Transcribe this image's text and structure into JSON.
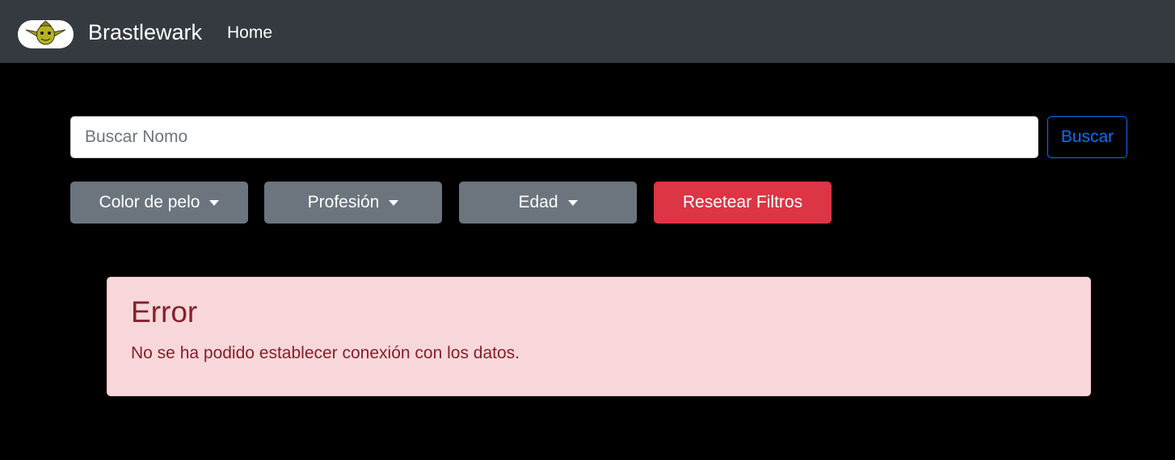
{
  "navbar": {
    "brand_name": "Brastlewark",
    "logo_icon": "goblin-logo-icon",
    "links": [
      {
        "label": "Home"
      }
    ],
    "background": "#343a40"
  },
  "search": {
    "placeholder": "Buscar Nomo",
    "value": "",
    "button_label": "Buscar"
  },
  "filters": [
    {
      "label": "Color de pelo",
      "type": "dropdown"
    },
    {
      "label": "Profesión",
      "type": "dropdown"
    },
    {
      "label": "Edad",
      "type": "dropdown"
    }
  ],
  "reset_button": {
    "label": "Resetear Filtros"
  },
  "alert": {
    "heading": "Error",
    "message": "No se ha podido establecer conexión con los datos.",
    "background": "#f8d7da",
    "text_color": "#842029"
  },
  "colors": {
    "page_background": "#000000",
    "primary": "#0d6efd",
    "secondary": "#6c757d",
    "danger": "#dc3545"
  }
}
